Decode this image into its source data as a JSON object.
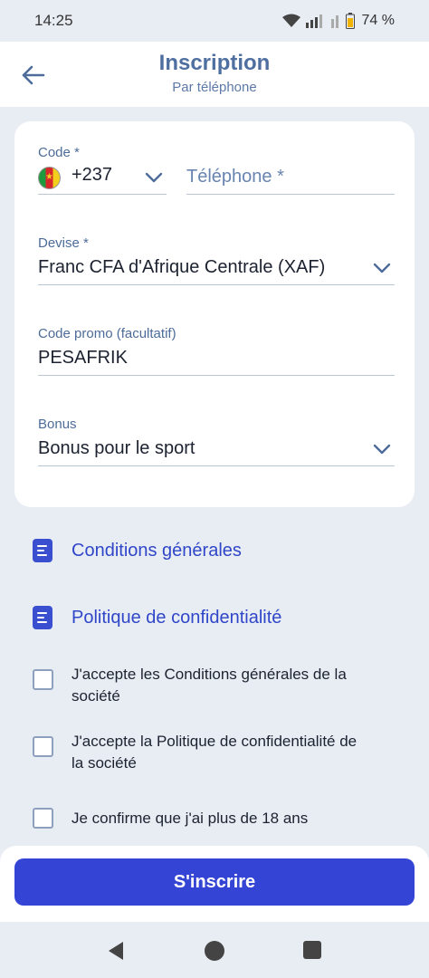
{
  "status_bar": {
    "time": "14:25",
    "battery": "74 %"
  },
  "header": {
    "title": "Inscription",
    "subtitle": "Par téléphone"
  },
  "form": {
    "code": {
      "label": "Code *",
      "value": "+237",
      "flag": "Cameroon"
    },
    "phone": {
      "placeholder": "Téléphone *"
    },
    "devise": {
      "label": "Devise *",
      "value": "Franc CFA d'Afrique Centrale (XAF)"
    },
    "promo": {
      "label": "Code promo (facultatif)",
      "value": "PESAFRIK"
    },
    "bonus": {
      "label": "Bonus",
      "value": "Bonus pour le sport"
    }
  },
  "links": {
    "terms": "Conditions générales",
    "privacy": "Politique de confidentialité"
  },
  "checkboxes": {
    "accept_terms": "J'accepte les Conditions générales de la société",
    "accept_privacy": "J'accepte la Politique de confidentialité de la société",
    "confirm_age": "Je confirme que j'ai plus de 18 ans"
  },
  "actions": {
    "submit": "S'inscrire"
  },
  "colors": {
    "accent": "#3444d4",
    "label": "#4d6c99",
    "background": "#e8edf4"
  }
}
